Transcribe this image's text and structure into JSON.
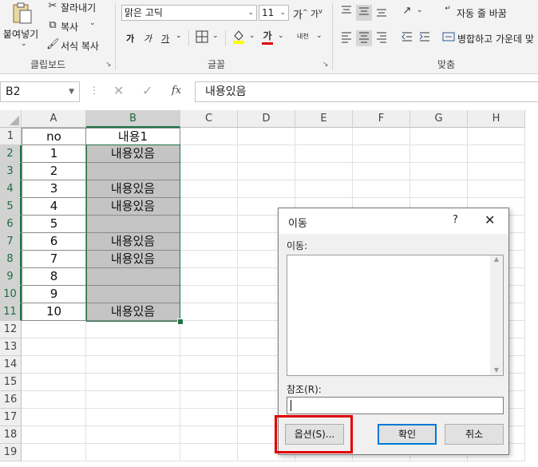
{
  "ribbon": {
    "clipboard": {
      "paste_label": "붙여넣기",
      "cut_label": "잘라내기",
      "copy_label": "복사",
      "format_painter_label": "서식 복사",
      "group_label": "클립보드"
    },
    "font": {
      "font_name": "맑은 고딕",
      "font_size": "11",
      "grow_label": "가",
      "shrink_label": "가",
      "bold_label": "가",
      "italic_label": "가",
      "underline_label": "가",
      "font_color_label": "가",
      "phonetic_label": "내천",
      "group_label": "글꼴",
      "font_color": "#e00000",
      "fill_color": "#ffff00"
    },
    "alignment": {
      "wrap_text_label": "자동 줄 바꿈",
      "merge_label": "병합하고 가운데 맞",
      "group_label": "맞춤"
    }
  },
  "formula_bar": {
    "name_box": "B2",
    "fx_label": "fx",
    "content": "내용있음"
  },
  "sheet": {
    "columns": [
      "A",
      "B",
      "C",
      "D",
      "E",
      "F",
      "G",
      "H"
    ],
    "rows": [
      "1",
      "2",
      "3",
      "4",
      "5",
      "6",
      "7",
      "8",
      "9",
      "10",
      "11",
      "12",
      "13",
      "14",
      "15",
      "16",
      "17",
      "18",
      "19"
    ],
    "cells": [
      [
        "no",
        "내용1"
      ],
      [
        "1",
        "내용있음"
      ],
      [
        "2",
        ""
      ],
      [
        "3",
        "내용있음"
      ],
      [
        "4",
        "내용있음"
      ],
      [
        "5",
        ""
      ],
      [
        "6",
        "내용있음"
      ],
      [
        "7",
        "내용있음"
      ],
      [
        "8",
        ""
      ],
      [
        "9",
        ""
      ],
      [
        "10",
        "내용있음"
      ]
    ],
    "gray_rows": [
      2,
      3,
      4,
      5,
      6,
      7,
      8,
      9,
      10,
      11
    ],
    "selection_color": "#217346"
  },
  "dialog": {
    "title": "이동",
    "help_label": "?",
    "close_label": "✕",
    "goto_label": "이동:",
    "reference_label": "참조(R):",
    "reference_value": "",
    "options_button": "옵션(S)...",
    "ok_button": "확인",
    "cancel_button": "취소",
    "highlight_color": "#e00000"
  }
}
